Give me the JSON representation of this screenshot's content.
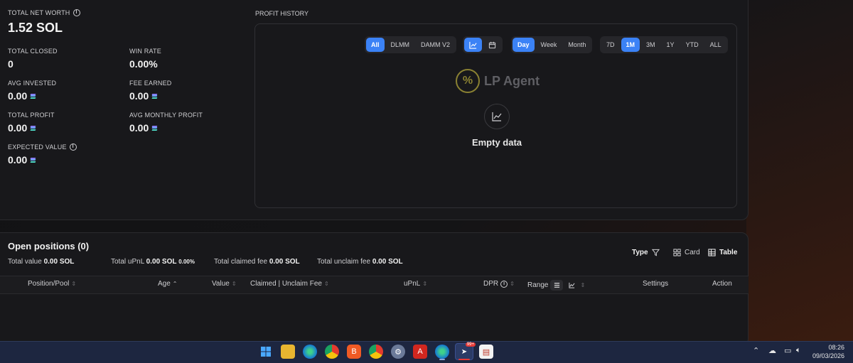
{
  "stats": {
    "total_net_worth_label": "TOTAL NET WORTH",
    "total_net_worth_value": "1.52 SOL",
    "total_closed_label": "TOTAL CLOSED",
    "total_closed_value": "0",
    "win_rate_label": "WIN RATE",
    "win_rate_value": "0.00%",
    "avg_invested_label": "AVG INVESTED",
    "avg_invested_value": "0.00",
    "fee_earned_label": "FEE EARNED",
    "fee_earned_value": "0.00",
    "total_profit_label": "TOTAL PROFIT",
    "total_profit_value": "0.00",
    "avg_monthly_profit_label": "AVG MONTHLY PROFIT",
    "avg_monthly_profit_value": "0.00",
    "expected_value_label": "EXPECTED VALUE",
    "expected_value_value": "0.00"
  },
  "profit_history": {
    "title": "PROFIT HISTORY",
    "pool_filters": [
      "All",
      "DLMM",
      "DAMM V2"
    ],
    "pool_active": "All",
    "view_icons": [
      "chart-icon",
      "calendar-icon"
    ],
    "period_filters": [
      "Day",
      "Week",
      "Month"
    ],
    "period_active": "Day",
    "range_filters": [
      "7D",
      "1M",
      "3M",
      "1Y",
      "YTD",
      "ALL"
    ],
    "range_active": "1M",
    "logo_text": "LP Agent",
    "empty_text": "Empty data"
  },
  "open_positions": {
    "title": "Open positions (0)",
    "total_value_label": "Total value",
    "total_value": "0.00 SOL",
    "total_upnl_label": "Total uPnL",
    "total_upnl": "0.00 SOL",
    "total_upnl_pct": "0.00%",
    "total_claimed_label": "Total claimed fee",
    "total_claimed": "0.00 SOL",
    "total_unclaim_label": "Total unclaim fee",
    "total_unclaim": "0.00 SOL",
    "type_label": "Type",
    "card_label": "Card",
    "table_label": "Table",
    "columns": {
      "position": "Position/Pool",
      "age": "Age",
      "value": "Value",
      "claimed": "Claimed | Unclaim Fee",
      "upnl": "uPnL",
      "dpr": "DPR",
      "range": "Range",
      "settings": "Settings",
      "action": "Action"
    }
  },
  "taskbar": {
    "time": "08:26",
    "date": "09/03/2026",
    "badge": "99+"
  },
  "colors": {
    "accent": "#3b82f6",
    "panel": "#18181b",
    "taskbar": "#1d2640"
  }
}
